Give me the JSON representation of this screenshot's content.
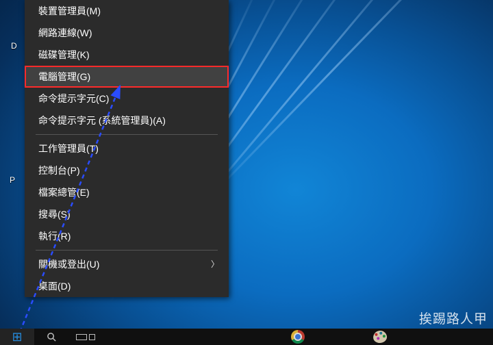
{
  "desktop_fragments": {
    "d_label": "D",
    "p_label": "P"
  },
  "context_menu": {
    "items": [
      {
        "label": "裝置管理員(M)"
      },
      {
        "label": "網路連線(W)"
      },
      {
        "label": "磁碟管理(K)"
      },
      {
        "label": "電腦管理(G)",
        "highlighted": true
      },
      {
        "label": "命令提示字元(C)"
      },
      {
        "label": "命令提示字元 (系統管理員)(A)"
      }
    ],
    "group2": [
      {
        "label": "工作管理員(T)"
      },
      {
        "label": "控制台(P)"
      },
      {
        "label": "檔案總管(E)"
      },
      {
        "label": "搜尋(S)"
      },
      {
        "label": "執行(R)"
      }
    ],
    "group3": [
      {
        "label": "關機或登出(U)",
        "submenu": true
      },
      {
        "label": "桌面(D)"
      }
    ]
  },
  "watermark": "挨踢路人甲",
  "taskbar": {
    "start": "⊞",
    "chrome_tip": "Google Chrome",
    "paint_tip": "小畫家"
  }
}
